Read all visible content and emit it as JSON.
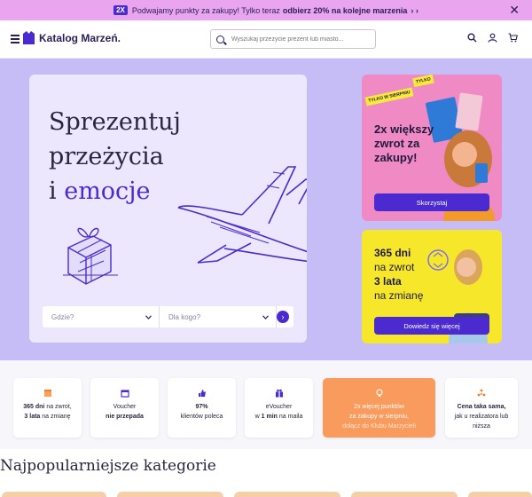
{
  "promo_bar": {
    "badge": "2X",
    "text": "Podwajamy punkty za zakupy! Tylko teraz",
    "highlight": "odbierz 20% na kolejne marzenia",
    "arrows": "› ›",
    "close": "✕"
  },
  "header": {
    "logo": "Katalog Marzeń.",
    "search_placeholder": "Wyszukaj przeżycie prezent lub miasto..."
  },
  "hero": {
    "title_line1": "Sprezentuj",
    "title_line2": "przeżycia",
    "title_line3_a": "i ",
    "title_line3_b": "emocje",
    "where_placeholder": "Gdzie?",
    "who_placeholder": "Dla kogo?",
    "go": "›"
  },
  "promo1": {
    "sticker_a": "TYLKO W SIERPNIU",
    "sticker_b": "TYLKO",
    "title": "2x większy zwrot za zakupy!",
    "button": "Skorzystaj"
  },
  "promo2": {
    "title_a": "365 dni",
    "title_b": "na zwrot",
    "title_c": "3 lata",
    "title_d": "na zmianę",
    "button": "Dowiedz się więcej"
  },
  "features": [
    {
      "line1_bold": "365 dni",
      "line1": " na zwrot,",
      "line2_bold": "3 lata",
      "line2": " na zmianę"
    },
    {
      "line1": "Voucher",
      "line2_bold": "nie przepada",
      "line2": ""
    },
    {
      "line1_bold": "97%",
      "line1": "",
      "line2": "klientów poleca"
    },
    {
      "line1": "eVoucher",
      "line2": "w ",
      "line2_bold": "1 min",
      "line2_tail": " na maila"
    },
    {
      "line1": "2x więcej punktów",
      "line2": "za zakupy w sierpniu,",
      "line3": "dołącz do Klubu Marzycieli"
    },
    {
      "line1_bold": "Cena taka sama,",
      "line2": "jak u realizatora lub",
      "line3": "niższa"
    }
  ],
  "section_title": "Najpopularniejsze kategorie",
  "colors": {
    "primary": "#4b2bcf",
    "hero_bg": "#c7bdf6",
    "promo_pink": "#f08ac4",
    "promo_yellow": "#f6e72b",
    "feature_orange": "#f99b5d"
  }
}
